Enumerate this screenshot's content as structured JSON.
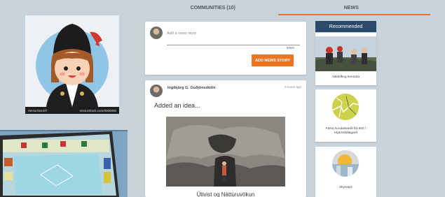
{
  "tabs": [
    {
      "label": "COMMUNITIES (10)"
    },
    {
      "label": "NEWS"
    }
  ],
  "avatar_card": {
    "watermark": "VectorStock®",
    "footer_url": "VectorStock.com/0000000"
  },
  "compose": {
    "placeholder": "Add a news story",
    "counter": "0/500",
    "button_label": "ADD NEWS STORY"
  },
  "post": {
    "author": "Ingibjörg G. Guðjónsdóttir",
    "time": "5 hours ago",
    "action": "Added an idea...",
    "caption": "Útivist og Náttúruvökun"
  },
  "recommended": {
    "header": "Recommended",
    "items": [
      {
        "label": "Valdefling kennara"
      },
      {
        "label": "Færa hundasvæði frá BSÍ í Hljómskálagarð"
      },
      {
        "label": "Skyways"
      }
    ]
  },
  "colors": {
    "accent": "#ee7422",
    "header": "#2c4a6b",
    "background": "#c9d3db"
  }
}
